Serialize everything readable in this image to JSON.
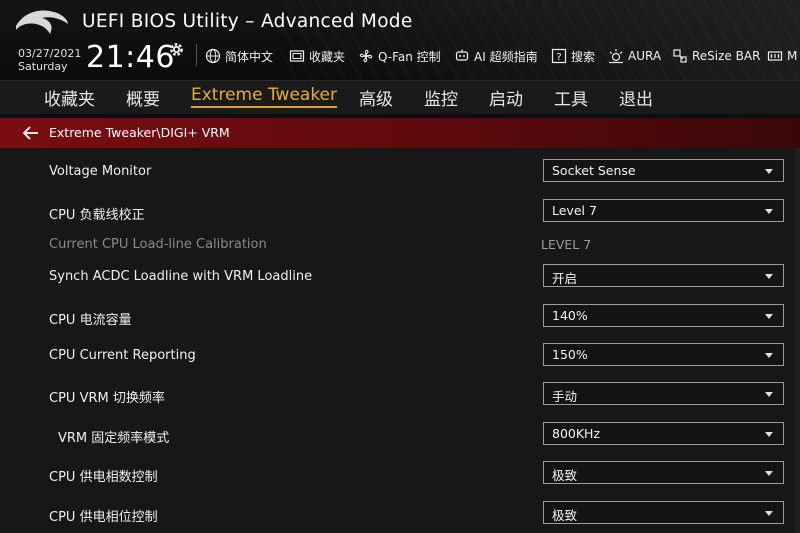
{
  "header": {
    "app_title": "UEFI BIOS Utility – Advanced Mode",
    "date": "03/27/2021",
    "weekday": "Saturday",
    "time": "21:46",
    "tools": [
      {
        "icon": "globe-icon",
        "label": "简体中文"
      },
      {
        "icon": "favorites-icon",
        "label": "收藏夹"
      },
      {
        "icon": "fan-icon",
        "label": "Q-Fan 控制"
      },
      {
        "icon": "ai-guide-icon",
        "label": "AI 超频指南"
      },
      {
        "icon": "help-search-icon",
        "label": "搜索"
      },
      {
        "icon": "aura-icon",
        "label": "AURA"
      },
      {
        "icon": "resize-bar-icon",
        "label": "ReSize BAR"
      },
      {
        "icon": "memtest-icon",
        "label": "M"
      }
    ]
  },
  "menu": {
    "items": [
      "收藏夹",
      "概要",
      "Extreme Tweaker",
      "高级",
      "监控",
      "启动",
      "工具",
      "退出"
    ],
    "active": "Extreme Tweaker"
  },
  "breadcrumb": {
    "path": "Extreme Tweaker\\DIGI+ VRM"
  },
  "settings": [
    {
      "label": "Voltage Monitor",
      "value": "Socket Sense"
    },
    {
      "label": "CPU 负载线校正",
      "value": "Level 7"
    },
    {
      "label": "Current CPU Load-line Calibration",
      "value": "LEVEL 7"
    },
    {
      "label": "Synch ACDC Loadline with VRM Loadline",
      "value": "开启"
    },
    {
      "label": "CPU 电流容量",
      "value": "140%"
    },
    {
      "label": "CPU Current Reporting",
      "value": "150%"
    },
    {
      "label": "CPU VRM 切换频率",
      "value": "手动"
    },
    {
      "label": "VRM 固定频率模式",
      "value": "800KHz"
    },
    {
      "label": "CPU 供电相数控制",
      "value": "极致"
    },
    {
      "label": "CPU 供电相位控制",
      "value": "极致"
    }
  ],
  "colors": {
    "accent": "#e6b02a",
    "breadcrumb_bg": "#7a0d12",
    "background": "#171717"
  }
}
